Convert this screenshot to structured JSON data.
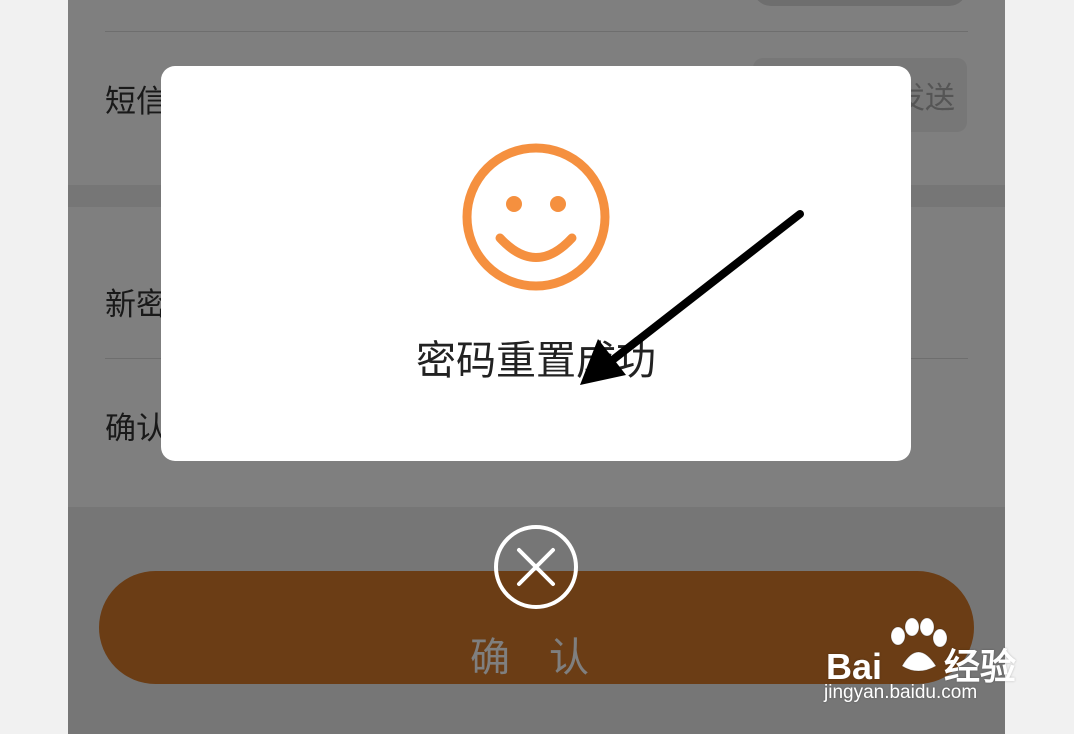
{
  "form": {
    "sms_label": "短信验证码",
    "send_button": "发送",
    "new_password_label": "新密码",
    "confirm_password_label": "确认密码",
    "submit_button": "确 认"
  },
  "modal": {
    "icon": "smiley-icon",
    "message": "密码重置成功",
    "close_icon": "close-circle-icon"
  },
  "colors": {
    "accent": "#F5903F",
    "button": "#D77A2A",
    "overlay": "rgba(0,0,0,0.5)"
  },
  "watermark": {
    "brand": "Bai",
    "brand_cn": "经验",
    "url": "jingyan.baidu.com"
  }
}
